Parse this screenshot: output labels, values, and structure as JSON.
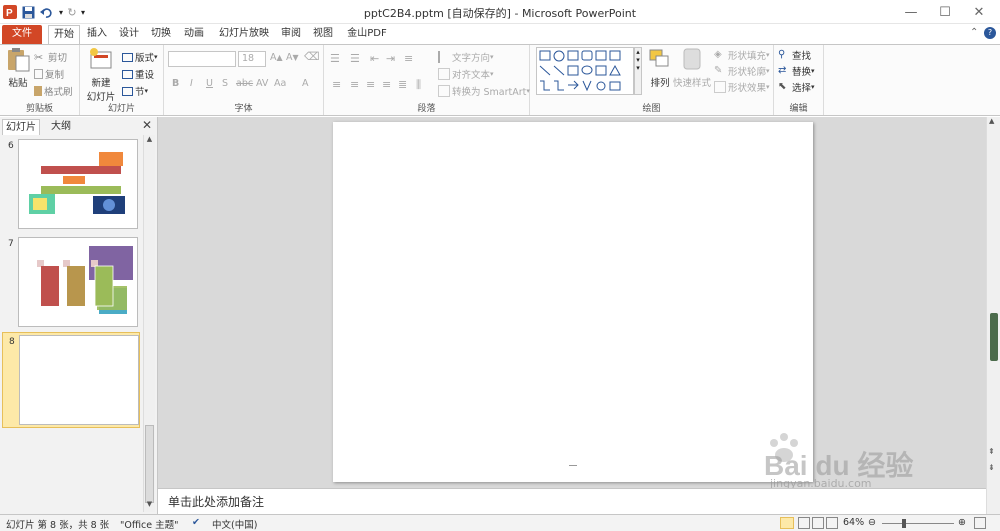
{
  "window": {
    "title": "pptC2B4.pptm [自动保存的] - Microsoft PowerPoint"
  },
  "colors": {
    "file_tab": "#d24726",
    "accent": "#2b579a",
    "selected_thumb": "#fde9a8"
  },
  "tabs": [
    {
      "label": "文件"
    },
    {
      "label": "开始"
    },
    {
      "label": "插入"
    },
    {
      "label": "设计"
    },
    {
      "label": "切换"
    },
    {
      "label": "动画"
    },
    {
      "label": "幻灯片放映"
    },
    {
      "label": "审阅"
    },
    {
      "label": "视图"
    },
    {
      "label": "金山PDF"
    }
  ],
  "ribbon": {
    "clipboard": {
      "paste": "粘贴",
      "cut": "剪切",
      "copy": "复制",
      "format_painter": "格式刷",
      "group": "剪贴板"
    },
    "slides": {
      "new_slide_1": "新建",
      "new_slide_2": "幻灯片",
      "layout": "版式",
      "reset": "重设",
      "section": "节",
      "group": "幻灯片"
    },
    "font": {
      "size": "18",
      "group": "字体",
      "bold": "B",
      "italic": "I",
      "underline": "U",
      "shadow": "S",
      "strike": "abc",
      "spacing": "AV",
      "case": "Aa"
    },
    "paragraph": {
      "text_direction": "文字方向",
      "align_text": "对齐文本",
      "smartart": "转换为 SmartArt",
      "group": "段落"
    },
    "drawing": {
      "arrange": "排列",
      "quick_styles": "快速样式",
      "fill": "形状填充",
      "outline": "形状轮廓",
      "effects": "形状效果",
      "group": "绘图"
    },
    "editing": {
      "find": "查找",
      "replace": "替换",
      "select": "选择",
      "group": "编辑"
    }
  },
  "panel": {
    "tab_slides": "幻灯片",
    "tab_outline": "大纲",
    "thumbs": [
      {
        "num": "6"
      },
      {
        "num": "7"
      },
      {
        "num": "8"
      }
    ]
  },
  "notes": {
    "placeholder": "单击此处添加备注"
  },
  "status": {
    "slide_info": "幻灯片 第 8 张，共 8 张",
    "theme": "\"Office 主题\"",
    "language": "中文(中国)",
    "zoom": "64%"
  },
  "watermark": {
    "brand": "Bai du 经验",
    "url": "jingyan.baidu.com"
  }
}
